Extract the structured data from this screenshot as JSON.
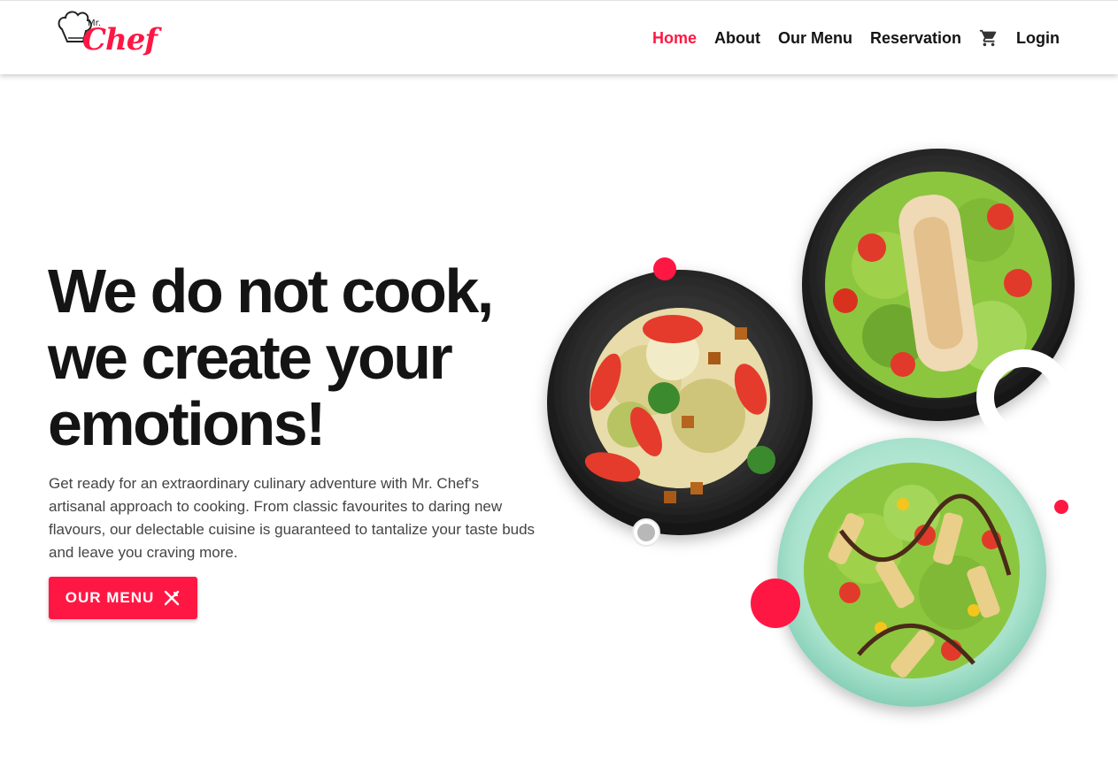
{
  "brand": {
    "logo_mr": "Mr.",
    "logo_chef": "Chef",
    "accent_color": "#ff1744"
  },
  "nav": {
    "items": [
      {
        "label": "Home",
        "active": true
      },
      {
        "label": "About",
        "active": false
      },
      {
        "label": "Our Menu",
        "active": false
      },
      {
        "label": "Reservation",
        "active": false
      }
    ],
    "cart_icon": "shopping-cart-icon",
    "login_label": "Login"
  },
  "hero": {
    "title_line1": "We do not cook,",
    "title_line2": "we create your",
    "title_line3": "emotions!",
    "description": "Get ready for an extraordinary culinary adventure with Mr. Chef's artisanal approach to cooking. From classic favourites to daring new flavours, our delectable cuisine is guaranteed to tantalize your taste buds and leave you craving more.",
    "button_label": "OUR MENU",
    "button_icon": "utensils-icon"
  },
  "images": {
    "plate_left": "egg-salad-plate",
    "plate_right_top": "chicken-salad-plate",
    "plate_right_bottom": "pasta-salad-plate"
  }
}
